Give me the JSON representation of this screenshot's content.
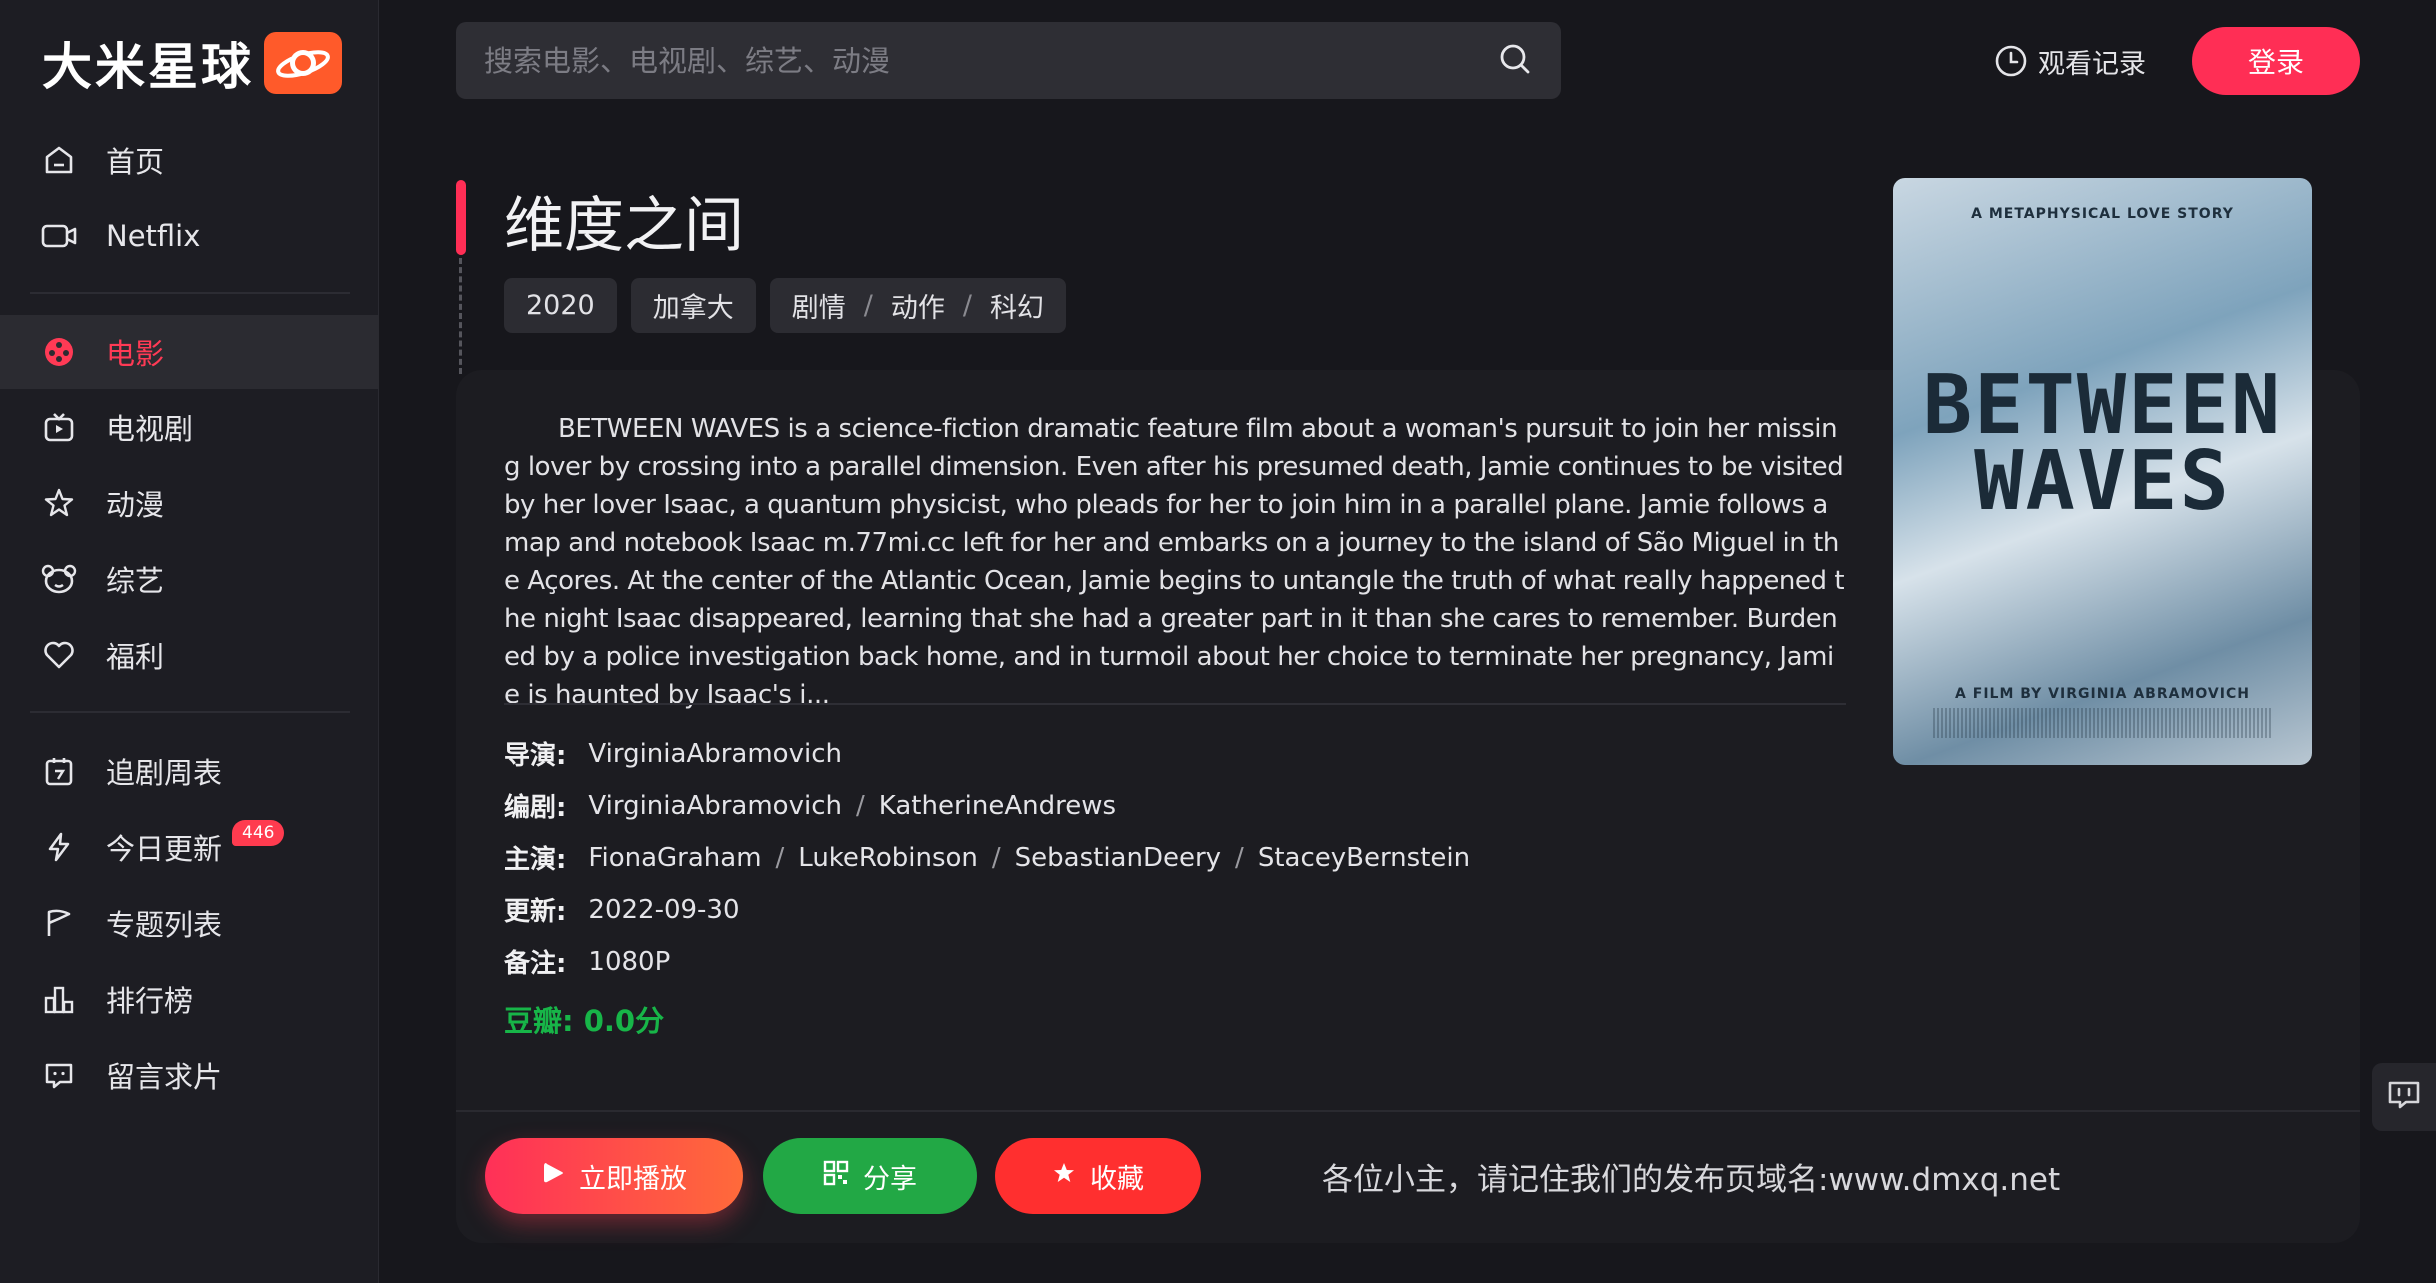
{
  "brand": {
    "name": "大米星球",
    "accent": "#ff2e55"
  },
  "sidebar": {
    "items": [
      {
        "label": "首页",
        "icon": "home-icon"
      },
      {
        "label": "Netflix",
        "icon": "video-camera-icon"
      },
      {
        "label": "电影",
        "icon": "film-reel-icon",
        "active": true
      },
      {
        "label": "电视剧",
        "icon": "tv-icon"
      },
      {
        "label": "动漫",
        "icon": "star-icon"
      },
      {
        "label": "综艺",
        "icon": "bear-icon"
      },
      {
        "label": "福利",
        "icon": "heart-icon"
      },
      {
        "label": "追剧周表",
        "icon": "calendar-icon"
      },
      {
        "label": "今日更新",
        "icon": "lightning-icon",
        "badge": "446"
      },
      {
        "label": "专题列表",
        "icon": "flag-icon"
      },
      {
        "label": "排行榜",
        "icon": "ranking-icon"
      },
      {
        "label": "留言求片",
        "icon": "message-icon"
      }
    ]
  },
  "header": {
    "search_placeholder": "搜索电影、电视剧、综艺、动漫",
    "history_label": "观看记录",
    "login_label": "登录"
  },
  "movie": {
    "title": "维度之间",
    "year": "2020",
    "region": "加拿大",
    "genres": [
      "剧情",
      "动作",
      "科幻"
    ],
    "genre_sep": "/",
    "description": "BETWEEN WAVES is a science-fiction dramatic feature film about a woman's pursuit to join her missing lover by crossing into a parallel dimension. Even after his presumed death, Jamie continues to be visited by her lover Isaac, a quantum physicist, who pleads for her to join him in a parallel plane. Jamie follows a map and notebook Isaac m.77mi.cc left for her and embarks on a journey to the island of São Miguel in the Açores. At the center of the Atlantic Ocean, Jamie begins to untangle the truth of what really happened the night Isaac disappeared, learning that she had a greater part in it than she cares to remember. Burdened by a police investigation back home, and in turmoil about her choice to terminate her pregnancy, Jamie is haunted by Isaac's i...",
    "director_label": "导演:",
    "director": "VirginiaAbramovich",
    "writer_label": "编剧:",
    "writers": [
      "VirginiaAbramovich",
      "KatherineAndrews"
    ],
    "cast_label": "主演:",
    "cast": [
      "FionaGraham",
      "LukeRobinson",
      "SebastianDeery",
      "StaceyBernstein"
    ],
    "update_label": "更新:",
    "update": "2022-09-30",
    "note_label": "备注:",
    "note": "1080P",
    "douban": "豆瓣: 0.0分",
    "poster": {
      "tagline": "A METAPHYSICAL LOVE STORY",
      "title_line1": "BETWEEN",
      "title_line2": "WAVES",
      "director": "A FILM BY VIRGINIA ABRAMOVICH"
    }
  },
  "actions": {
    "play_label": "立即播放",
    "share_label": "分享",
    "fav_label": "收藏"
  },
  "notice": "各位小主，请记住我们的发布页域名:www.dmxq.net"
}
